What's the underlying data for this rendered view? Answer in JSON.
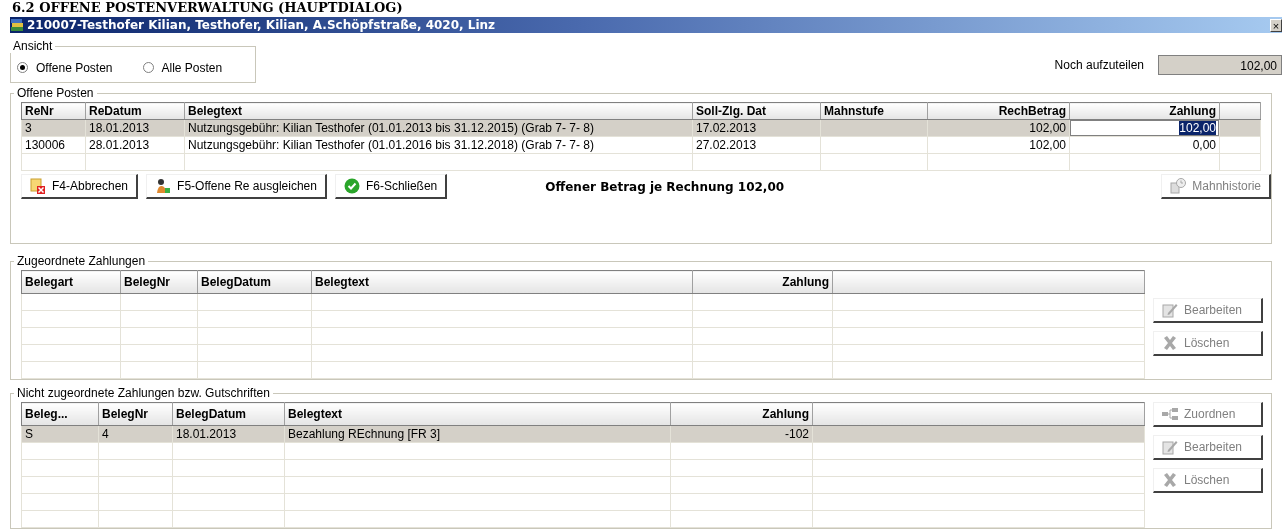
{
  "document_heading": "6.2 OFFENE POSTENVERWALTUNG (HAUPTDIALOG)",
  "window": {
    "title": "210007-Testhofer Kilian, Testhofer, Kilian, A.Schöpfstraße, 4020, Linz",
    "close": "×"
  },
  "view": {
    "label": "Ansicht",
    "options": [
      {
        "label": "Offene Posten",
        "selected": true
      },
      {
        "label": "Alle Posten",
        "selected": false
      }
    ]
  },
  "remaining": {
    "label": "Noch aufzuteilen",
    "value": "102,00"
  },
  "groups": [
    {
      "title": "Offene Posten",
      "kind": "invoices",
      "table": {
        "columns": [
          "ReNr",
          "ReDatum",
          "Belegtext",
          "Soll-Zlg. Dat",
          "Mahnstufe",
          "RechBetrag",
          "Zahlung"
        ],
        "rows": [
          {
            "cells": [
              "3",
              "18.01.2013",
              "Nutzungsgebühr: Kilian Testhofer (01.01.2013 bis 31.12.2015) (Grab  7- 7-  8)",
              "17.02.2013",
              "",
              "102,00",
              "102,00"
            ],
            "selected": true,
            "editing": true
          },
          {
            "cells": [
              "130006",
              "28.01.2013",
              "Nutzungsgebühr: Kilian Testhofer (01.01.2016 bis 31.12.2018) (Grab  7- 7-  8)",
              "27.02.2013",
              "",
              "102,00",
              "0,00"
            ],
            "selected": false,
            "editing": false
          }
        ]
      },
      "buttons": [
        {
          "label": "F4-Abbrechen",
          "disabled": false
        },
        {
          "label": "F5-Offene Re ausgleichen",
          "disabled": false
        },
        {
          "label": "F6-Schließen",
          "disabled": false
        }
      ],
      "summary": "Offener Betrag je Rechnung 102,00",
      "side_buttons": [
        {
          "label": "Mahnhistorie",
          "disabled": true
        }
      ]
    },
    {
      "title": "Zugeordnete Zahlungen",
      "kind": "payments",
      "table": {
        "columns": [
          "Belegart",
          "BelegNr",
          "BelegDatum",
          "Belegtext",
          "Zahlung"
        ]
      },
      "side_buttons": [
        {
          "label": "Bearbeiten",
          "disabled": true
        },
        {
          "label": "Löschen",
          "disabled": true
        }
      ]
    },
    {
      "title": "Nicht zugeordnete Zahlungen bzw. Gutschriften",
      "kind": "payments",
      "table": {
        "columns": [
          "Beleg...",
          "BelegNr",
          "BelegDatum",
          "Belegtext",
          "Zahlung"
        ],
        "rows": [
          {
            "cells": [
              "S",
              "4",
              "18.01.2013",
              "Bezahlung REchnung [FR 3]",
              "-102"
            ],
            "selected": true
          }
        ]
      },
      "side_buttons": [
        {
          "label": "Zuordnen",
          "disabled": true
        },
        {
          "label": "Bearbeiten",
          "disabled": true
        },
        {
          "label": "Löschen",
          "disabled": true
        }
      ]
    }
  ]
}
